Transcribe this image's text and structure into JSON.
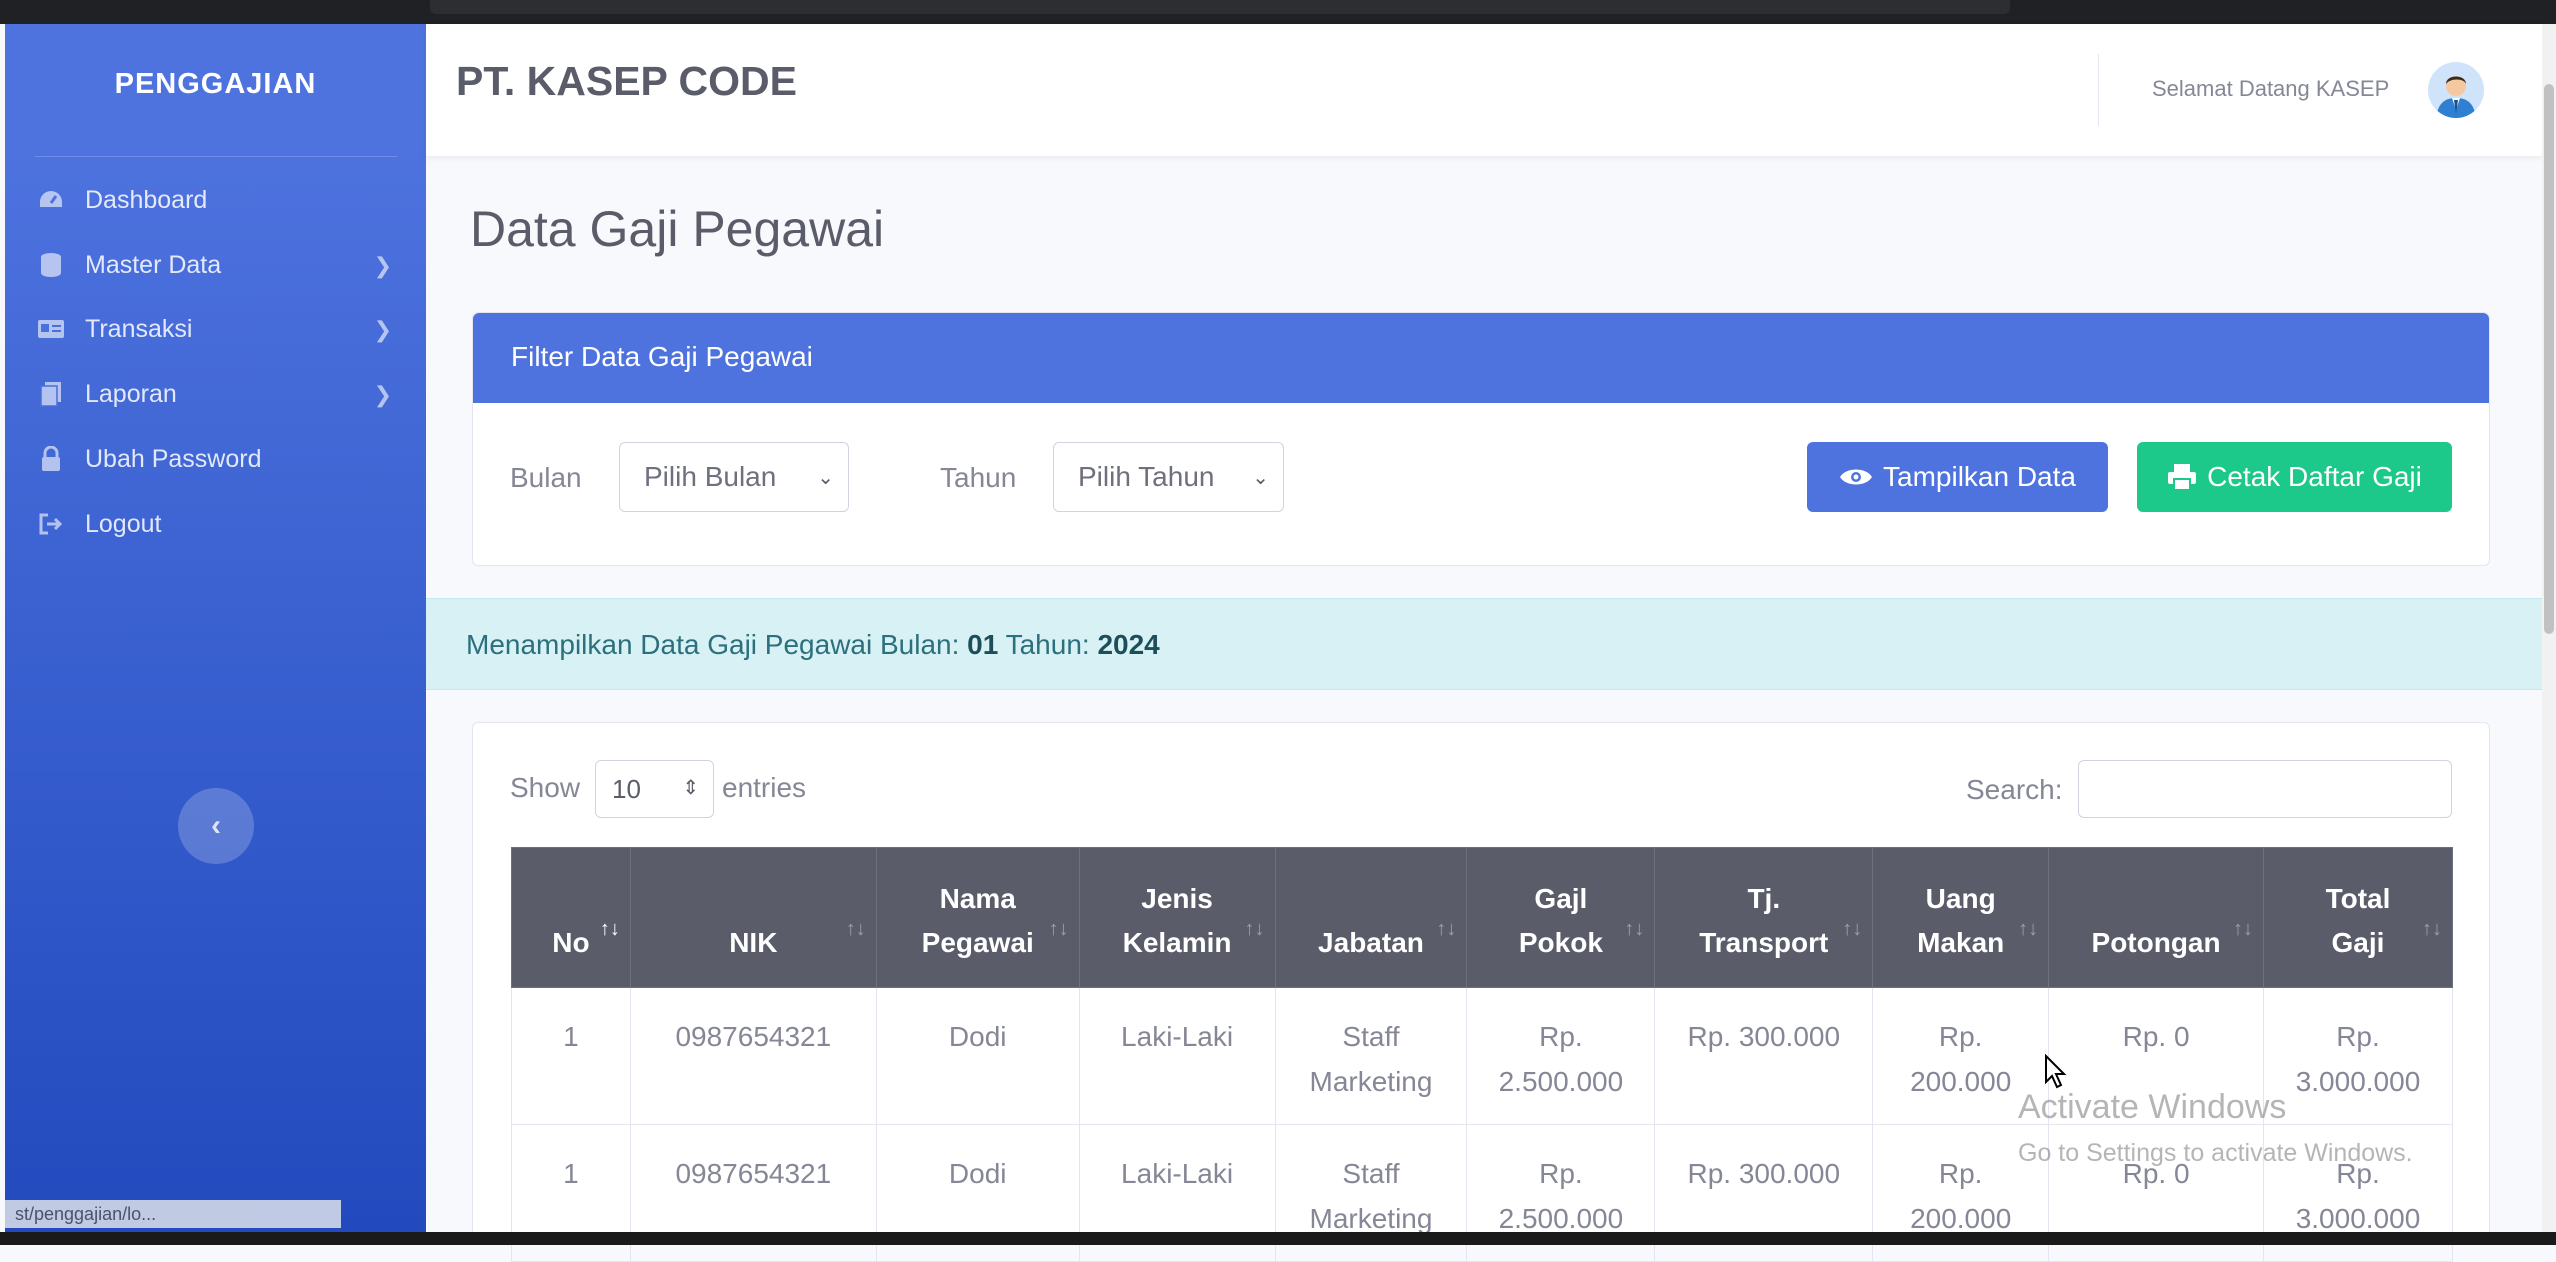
{
  "sidebar": {
    "brand": "PENGGAJIAN",
    "items": [
      {
        "label": "Dashboard",
        "icon": "tachometer-icon",
        "has_submenu": false
      },
      {
        "label": "Master Data",
        "icon": "database-icon",
        "has_submenu": true
      },
      {
        "label": "Transaksi",
        "icon": "id-card-icon",
        "has_submenu": true
      },
      {
        "label": "Laporan",
        "icon": "copy-icon",
        "has_submenu": true
      },
      {
        "label": "Ubah Password",
        "icon": "lock-icon",
        "has_submenu": false
      },
      {
        "label": "Logout",
        "icon": "sign-out-icon",
        "has_submenu": false
      }
    ],
    "status_url": "st/penggajian/lo..."
  },
  "topbar": {
    "company": "PT. KASEP CODE",
    "welcome": "Selamat Datang KASEP"
  },
  "page": {
    "title": "Data Gaji Pegawai"
  },
  "filter": {
    "header": "Filter Data Gaji Pegawai",
    "month_label": "Bulan",
    "month_value": "Pilih Bulan",
    "year_label": "Tahun",
    "year_value": "Pilih Tahun",
    "show_button": "Tampilkan Data",
    "print_button": "Cetak Daftar Gaji"
  },
  "info": {
    "prefix": "Menampilkan Data Gaji Pegawai Bulan:",
    "month": "01",
    "year_prefix": "Tahun:",
    "year": "2024"
  },
  "table": {
    "show_label": "Show",
    "entries_label": "entries",
    "page_length": "10",
    "search_label": "Search:",
    "columns": [
      [
        "No"
      ],
      [
        "NIK"
      ],
      [
        "Nama",
        "Pegawai"
      ],
      [
        "Jenis",
        "Kelamin"
      ],
      [
        "Jabatan"
      ],
      [
        "Gajl",
        "Pokok"
      ],
      [
        "Tj.",
        "Transport"
      ],
      [
        "Uang",
        "Makan"
      ],
      [
        "Potongan"
      ],
      [
        "Total",
        "Gaji"
      ]
    ],
    "rows": [
      {
        "no": "1",
        "nik": "0987654321",
        "nama": "Dodi",
        "jk": "Laki-Laki",
        "jabatan": [
          "Staff",
          "Marketing"
        ],
        "gaji": [
          "Rp.",
          "2.500.000"
        ],
        "transport": "Rp. 300.000",
        "makan": [
          "Rp.",
          "200.000"
        ],
        "potongan": "Rp. 0",
        "total": [
          "Rp.",
          "3.000.000"
        ]
      },
      {
        "no": "1",
        "nik": "0987654321",
        "nama": "Dodi",
        "jk": "Laki-Laki",
        "jabatan": [
          "Staff",
          "Marketing"
        ],
        "gaji": [
          "Rp.",
          "2.500.000"
        ],
        "transport": "Rp. 300.000",
        "makan": [
          "Rp.",
          "200.000"
        ],
        "potongan": "Rp. 0",
        "total": [
          "Rp.",
          "3.000.000"
        ]
      }
    ]
  },
  "watermark": {
    "line1": "Activate Windows",
    "line2": "Go to Settings to activate Windows."
  },
  "colors": {
    "primary": "#4e73df",
    "success": "#1cc88a",
    "info_bg": "#d7f1f5",
    "table_head": "#5a5c69"
  }
}
